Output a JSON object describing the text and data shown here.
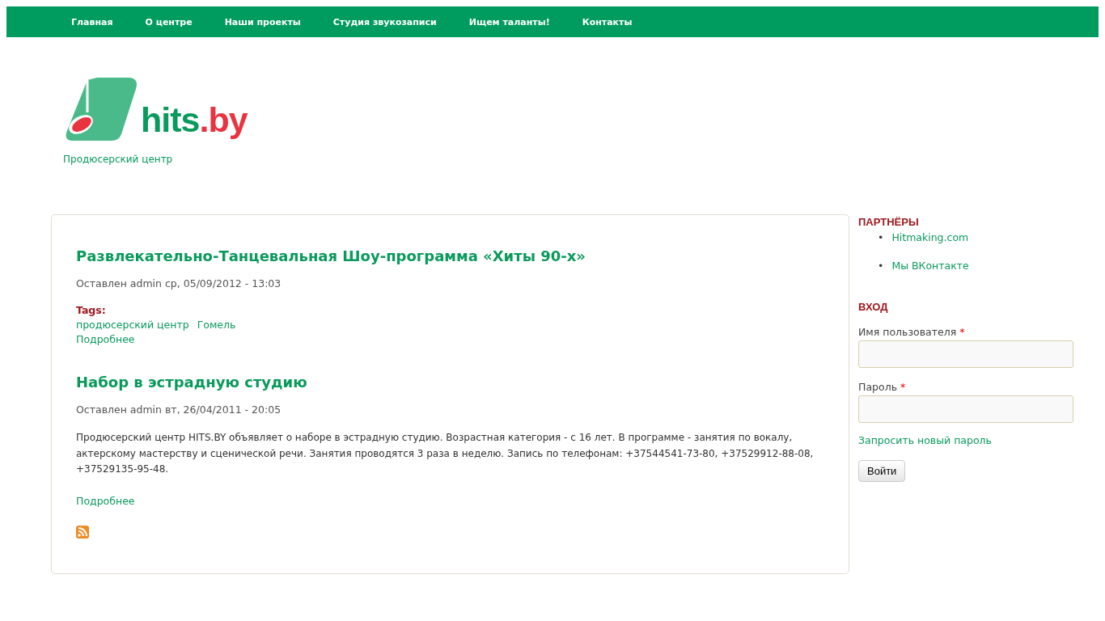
{
  "nav": {
    "items": [
      {
        "label": "Главная"
      },
      {
        "label": "О центре"
      },
      {
        "label": "Наши проекты"
      },
      {
        "label": "Студия звукозаписи"
      },
      {
        "label": "Ищем таланты!"
      },
      {
        "label": "Контакты"
      }
    ]
  },
  "header": {
    "logo_name": "hits",
    "logo_suffix": ".by",
    "slogan": "Продюсерский центр"
  },
  "posts": [
    {
      "title": "Развлекательно-Танцевальная Шоу-программа «Хиты 90-х»",
      "meta": "Оставлен admin ср, 05/09/2012 - 13:03",
      "tags_label": "Tags:",
      "tags": [
        "продюсерский центр",
        "Гомель"
      ],
      "more": "Подробнее"
    },
    {
      "title": "Набор в эстрадную студию",
      "meta": "Оставлен admin вт, 26/04/2011 - 20:05",
      "body": "Продюсерский центр HITS.BY объявляет о наборе в эстрадную студию. Возрастная категория - с 16 лет. В программе - занятия по вокалу, актерскому мастерству и сценической речи. Занятия проводятся 3 раза в неделю. Запись по телефонам: +37544541-73-80, +37529912-88-08, +37529135-95-48.",
      "more": "Подробнее"
    }
  ],
  "sidebar": {
    "partners": {
      "title": "ПАРТНЁРЫ",
      "links": [
        {
          "bullet": "•",
          "label": "Hitmaking.com"
        },
        {
          "bullet": "•",
          "label": "Мы ВКонтакте"
        }
      ]
    },
    "login": {
      "title": "ВХОД",
      "fields": [
        {
          "label": "Имя пользователя",
          "required_mark": "*"
        },
        {
          "label": "Пароль",
          "required_mark": "*"
        }
      ],
      "reset_link": "Запросить новый пароль",
      "submit": "Войти"
    }
  }
}
